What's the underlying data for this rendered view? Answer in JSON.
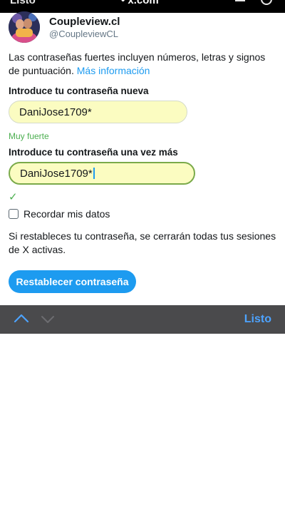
{
  "status_bar": {
    "left_label": "Listo",
    "center_label": "• x.com"
  },
  "account": {
    "name": "Coupleview.cl",
    "handle": "@CoupleviewCL"
  },
  "intro": {
    "text": "Las contraseñas fuertes incluyen números, letras y signos de puntuación.",
    "link": "Más información"
  },
  "new_password": {
    "label": "Introduce tu contraseña nueva",
    "value": "DaniJose1709*"
  },
  "strength_text": "Muy fuerte",
  "confirm_password": {
    "label": "Introduce tu contraseña una vez más",
    "value": "DaniJose1709*",
    "match_symbol": "✓"
  },
  "remember": {
    "label": "Recordar mis datos",
    "checked": false
  },
  "note": "Si restableces tu contraseña, se cerrarán todas tus sesiones de X activas.",
  "submit_label": "Restablecer contraseña",
  "keyboard_toolbar": {
    "done_label": "Listo",
    "up_icon": "chevron-up-icon",
    "down_icon": "chevron-down-icon"
  },
  "colors": {
    "accent": "#1d9bf0",
    "success": "#4caf50",
    "field_background": "#fbfcc1",
    "toolbar_background": "#4a4a4c"
  }
}
